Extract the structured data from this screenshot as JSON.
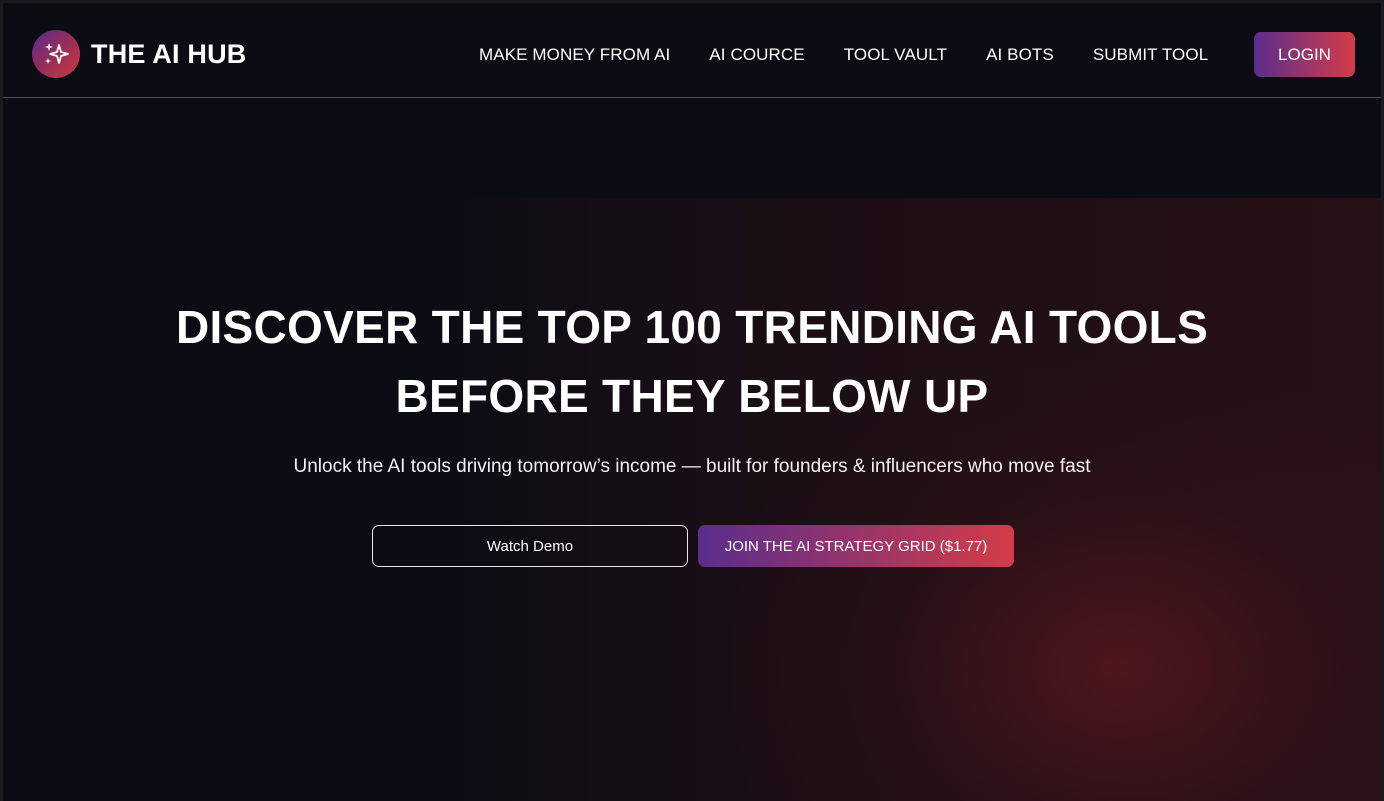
{
  "brand": {
    "name": "THE AI HUB",
    "logo_icon": "sparkles-icon"
  },
  "nav": {
    "items": [
      {
        "label": "MAKE MONEY FROM AI"
      },
      {
        "label": "AI COURCE"
      },
      {
        "label": "TOOL VAULT"
      },
      {
        "label": "AI BOTS"
      },
      {
        "label": "SUBMIT TOOL"
      }
    ],
    "login_label": "LOGIN"
  },
  "hero": {
    "title_line1": "DISCOVER THE TOP 100 TRENDING AI TOOLS",
    "title_line2": "BEFORE THEY BELOW UP",
    "subtitle": "Unlock the AI tools driving tomorrow’s income — built for founders & influencers who move fast",
    "watch_demo_label": "Watch Demo",
    "join_label": "JOIN THE AI STRATEGY GRID ($1.77)"
  },
  "colors": {
    "background": "#0c0c14",
    "accent_start": "#5a2d8c",
    "accent_end": "#d43c48",
    "text": "#ffffff"
  }
}
